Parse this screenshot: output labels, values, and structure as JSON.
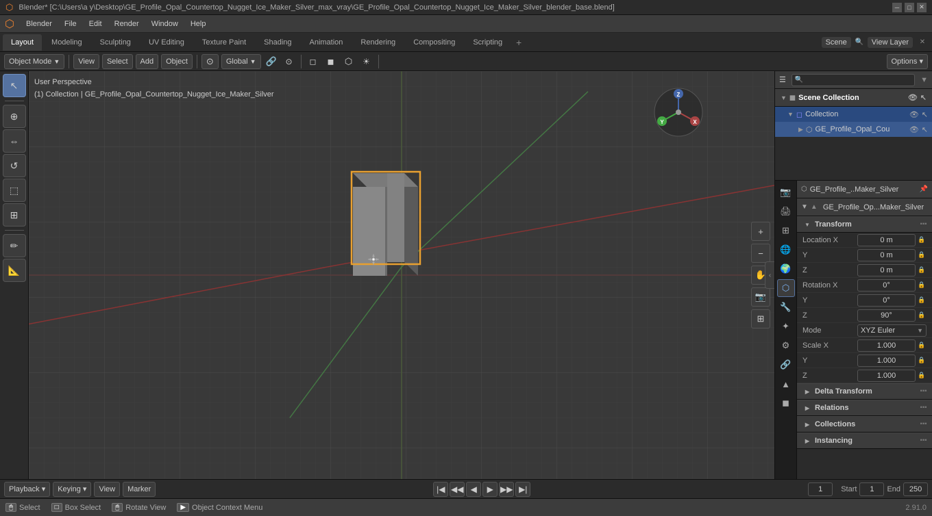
{
  "titleBar": {
    "title": "Blender* [C:\\Users\\a y\\Desktop\\GE_Profile_Opal_Countertop_Nugget_Ice_Maker_Silver_max_vray\\GE_Profile_Opal_Countertop_Nugget_Ice_Maker_Silver_blender_base.blend]",
    "controls": {
      "minimize": "─",
      "maximize": "□",
      "close": "✕"
    }
  },
  "menuBar": {
    "logo": "⬡",
    "items": [
      "Blender",
      "File",
      "Edit",
      "Render",
      "Window",
      "Help"
    ]
  },
  "workspaceTabs": {
    "tabs": [
      "Layout",
      "Modeling",
      "Sculpting",
      "UV Editing",
      "Texture Paint",
      "Shading",
      "Animation",
      "Rendering",
      "Compositing",
      "Scripting"
    ],
    "activeTab": "Layout",
    "addBtn": "+",
    "viewLayerLabel": "View Layer",
    "sceneName": "Scene"
  },
  "viewportHeader": {
    "objectMode": "Object Mode",
    "view": "View",
    "select": "Select",
    "add": "Add",
    "object": "Object",
    "global": "Global",
    "options": "Options ▾"
  },
  "viewport": {
    "info": {
      "line1": "User Perspective",
      "line2": "(1) Collection | GE_Profile_Opal_Countertop_Nugget_Ice_Maker_Silver"
    }
  },
  "leftToolbar": {
    "tools": [
      "↖",
      "⇔",
      "↺",
      "⬚",
      "⬡",
      "✏",
      "📐"
    ]
  },
  "outliner": {
    "sceneCollection": "Scene Collection",
    "collection": "Collection",
    "activeObject": "GE_Profile_Opal_Cou",
    "searchPlaceholder": "🔍"
  },
  "propertiesPanel": {
    "objectName": "GE_Profile_..Maker_Silver",
    "meshName": "GE_Profile_Op...Maker_Silver",
    "sections": {
      "transform": {
        "label": "Transform",
        "location": {
          "label": "Location X",
          "x": "0 m",
          "y": "0 m",
          "z": "0 m"
        },
        "rotation": {
          "label": "Rotation X",
          "x": "0°",
          "y": "0°",
          "z": "90°"
        },
        "mode": "XYZ Euler",
        "scale": {
          "label": "Scale X",
          "x": "1.000",
          "y": "1.000",
          "z": "1.000"
        }
      },
      "deltaTransform": "Delta Transform",
      "relations": "Relations",
      "collections": "Collections",
      "instancing": "Instancing"
    }
  },
  "bottomBar": {
    "playback": "Playback ▾",
    "keying": "Keying ▾",
    "view": "View",
    "marker": "Marker",
    "frameStart": "Start",
    "startFrame": "1",
    "frameEnd": "End",
    "endFrame": "250",
    "currentFrame": "1",
    "playIcon": "▶"
  },
  "statusBar": {
    "select": "Select",
    "selectKey": "🖱",
    "boxSelect": "Box Select",
    "boxKey": "□",
    "rotateView": "Rotate View",
    "objectContextMenu": "Object Context Menu",
    "version": "2.91.0"
  }
}
